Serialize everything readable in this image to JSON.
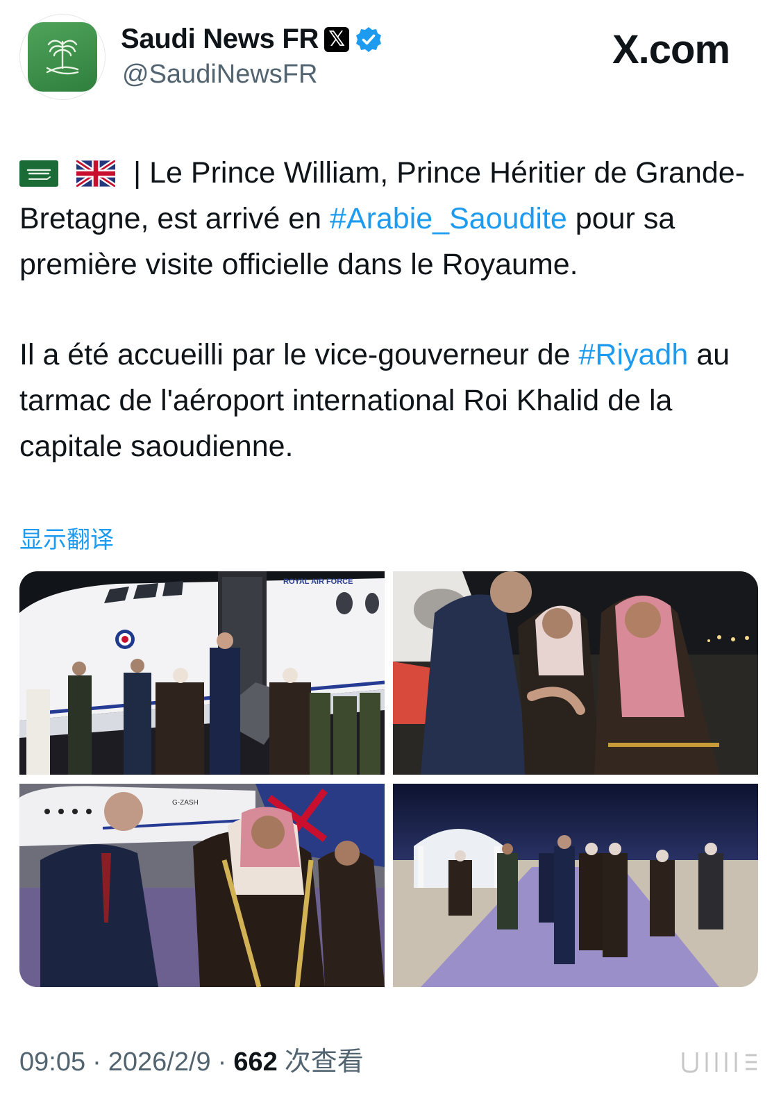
{
  "account": {
    "display_name": "Saudi News FR",
    "handle": "@SaudiNewsFR",
    "verified": true,
    "affiliate_badge": "x-icon",
    "avatar_icon": "saudi-emblem-icon"
  },
  "site_logo": "X.com",
  "tweet": {
    "flags": [
      "saudi-flag-icon",
      "uk-flag-icon"
    ],
    "line1_pre": "| Le Prince William, Prince Héritier de Grande-Bretagne, est arrivé en ",
    "hashtag1": "#Arabie_Saoudite",
    "line1_post": " pour sa première visite officielle dans le Royaume.",
    "line2_pre": "Il a été accueilli par le vice-gouverneur de ",
    "hashtag2": "#Riyadh",
    "line2_post": " au tarmac de l'aéroport international Roi Khalid de la capitale saoudienne."
  },
  "translate_link": "显示翻译",
  "photos": {
    "p1_caption_text": "ROYAL AIR FORCE",
    "p3_plane_text": "G-ZASH"
  },
  "footer": {
    "time": "09:05",
    "date": "2026/2/9",
    "views": "662",
    "views_label": "次查看"
  },
  "colors": {
    "link": "#1d9bf0",
    "secondary_text": "#536471",
    "verified": "#1d9bf0",
    "avatar_green": "#3a8f48"
  }
}
